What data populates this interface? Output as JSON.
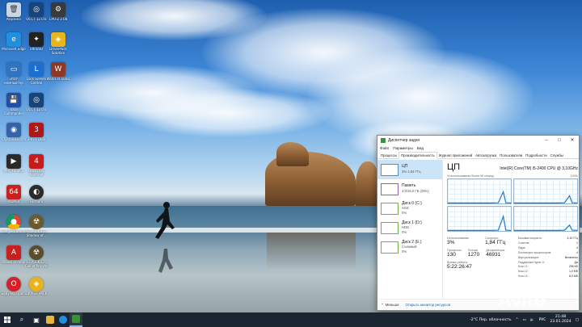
{
  "desktop_icons": [
    {
      "label": "Корзина",
      "color": "#c9d6e3"
    },
    {
      "label": "Microsoft Edge",
      "color": "#1f8fe0"
    },
    {
      "label": "Этот компьютер",
      "color": "#2f74c0"
    },
    {
      "label": "Total Commander",
      "color": "#1f4fa6"
    },
    {
      "label": "CrystalDiskInfo",
      "color": "#3563a8"
    },
    {
      "label": "MPC-HC x64",
      "color": "#2a2a2a"
    },
    {
      "label": "AIDA64",
      "color": "#c8211f"
    },
    {
      "label": "Google Chrome",
      "color": "#e0a416"
    },
    {
      "label": "Adobe Acrobat",
      "color": "#c8201f"
    },
    {
      "label": "Браузер Opera",
      "color": "#d3202a"
    },
    {
      "label": "OCCT 12.0.6",
      "color": "#17457a"
    },
    {
      "label": "UltraISO",
      "color": "#222222"
    },
    {
      "label": "Lock Screen Control",
      "color": "#1a6fd0"
    },
    {
      "label": "OCCT 12.0.6",
      "color": "#17457a"
    },
    {
      "label": "3-In-1 Dual",
      "color": "#b01717"
    },
    {
      "label": "Hard Disk Sentinel",
      "color": "#c81a1a"
    },
    {
      "label": "Furmark",
      "color": "#2b2b2b"
    },
    {
      "label": "S.T.A.L.K.E.R. Shadow of...",
      "color": "#6c5a2b"
    },
    {
      "label": "S.T.A.L.K.E.R. Call of Pripyat",
      "color": "#5b4d2a"
    },
    {
      "label": "DRIVER PACK",
      "color": "#e9b21b"
    },
    {
      "label": "CPU-Z 2.08",
      "color": "#3a3a3a"
    },
    {
      "label": "DriverPack Solution",
      "color": "#e8b51b"
    },
    {
      "label": "World of Tanks",
      "color": "#8c3a26"
    }
  ],
  "task_manager": {
    "title": "Диспетчер задач",
    "menu": [
      "Файл",
      "Параметры",
      "Вид"
    ],
    "tabs": [
      {
        "label": "Процессы",
        "active": false
      },
      {
        "label": "Производительность",
        "active": true
      },
      {
        "label": "Журнал приложений",
        "active": false
      },
      {
        "label": "Автозагрузка",
        "active": false
      },
      {
        "label": "Пользователи",
        "active": false
      },
      {
        "label": "Подробности",
        "active": false
      },
      {
        "label": "Службы",
        "active": false
      }
    ],
    "resources": [
      {
        "name": "ЦП",
        "sub": "3% 1,84 ГГц",
        "type": "cpu",
        "selected": true
      },
      {
        "name": "Память",
        "sub": "4,0/16,0 ГБ (25%)",
        "type": "mem",
        "selected": false
      },
      {
        "name": "Диск 0 (C:)",
        "sub": "SSD\n0%",
        "type": "disk",
        "selected": false
      },
      {
        "name": "Диск 1 (D:)",
        "sub": "HDD\n0%",
        "type": "disk",
        "selected": false
      },
      {
        "name": "Диск 2 (E:)",
        "sub": "Съемный\n0%",
        "type": "disk",
        "selected": false
      }
    ],
    "cpu": {
      "title": "ЦП",
      "model": "Intel(R) Core(TM) i5-2400 CPU @ 3,10GHz",
      "graph_caption_left": "% использования более 60 секунд",
      "graph_caption_right": "100%",
      "core_spike_percent": [
        12,
        8,
        15,
        6
      ],
      "stats": {
        "utilization_label": "Использование",
        "utilization_value": "3%",
        "speed_label": "Скорость",
        "speed_value": "1,84 ГГц",
        "processes_label": "Процессы",
        "processes_value": "130",
        "threads_label": "Потоки",
        "threads_value": "1270",
        "handles_label": "Дескрипторы",
        "handles_value": "46931",
        "uptime_label": "Время работы",
        "uptime_value": "5:22:26:47"
      },
      "details": [
        {
          "k": "Базовая скорость:",
          "v": "3,10 ГГц"
        },
        {
          "k": "Сокетов:",
          "v": "1"
        },
        {
          "k": "Ядра:",
          "v": "4"
        },
        {
          "k": "Логических процессоров:",
          "v": "4"
        },
        {
          "k": "Виртуализация:",
          "v": "Включено"
        },
        {
          "k": "Поддержка Hyper-V:",
          "v": "Да"
        },
        {
          "k": "Кэш L1:",
          "v": "256 КБ"
        },
        {
          "k": "Кэш L2:",
          "v": "1,0 МБ"
        },
        {
          "k": "Кэш L3:",
          "v": "6,0 МБ"
        }
      ]
    },
    "footer": {
      "less": "Меньше",
      "monitor": "Открыть монитор ресурсов"
    }
  },
  "taskbar": {
    "weather": "-2°C  Пер. облачность",
    "lang": "РУС",
    "time": "21:48",
    "date": "23.01.2024"
  },
  "watermark": "Avito"
}
